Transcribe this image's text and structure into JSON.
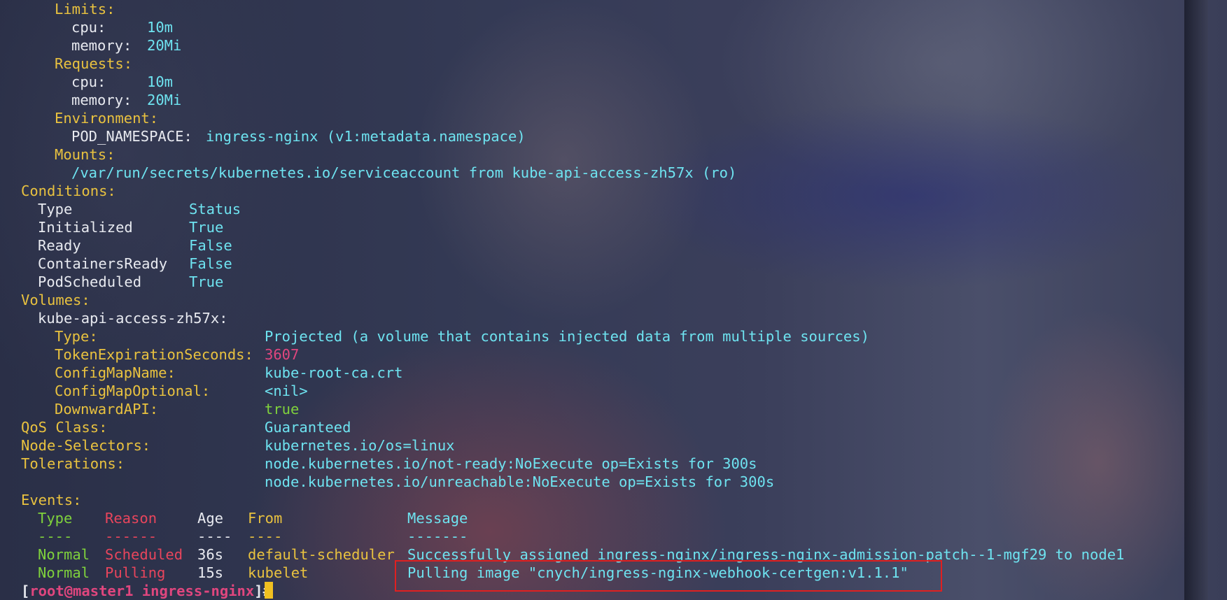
{
  "limits": {
    "heading": "Limits",
    "cpu_label": "cpu:",
    "cpu_value": "10m",
    "memory_label": "memory:",
    "memory_value": "20Mi"
  },
  "requests": {
    "heading": "Requests",
    "cpu_label": "cpu:",
    "cpu_value": "10m",
    "memory_label": "memory:",
    "memory_value": "20Mi"
  },
  "environment": {
    "heading": "Environment",
    "var_name": "POD_NAMESPACE:",
    "var_value": "ingress-nginx (v1:metadata.namespace)"
  },
  "mounts": {
    "heading": "Mounts",
    "value": "/var/run/secrets/kubernetes.io/serviceaccount from kube-api-access-zh57x (ro)"
  },
  "conditions": {
    "heading": "Conditions",
    "col_type": "Type",
    "col_status": "Status",
    "rows": [
      {
        "type": "Initialized",
        "status": "True"
      },
      {
        "type": "Ready",
        "status": "False"
      },
      {
        "type": "ContainersReady",
        "status": "False"
      },
      {
        "type": "PodScheduled",
        "status": "True"
      }
    ]
  },
  "volumes": {
    "heading": "Volumes",
    "name": "kube-api-access-zh57x:",
    "type_label": "Type:",
    "type_value": "Projected (a volume that contains injected data from multiple sources)",
    "token_label": "TokenExpirationSeconds:",
    "token_value": "3607",
    "cm_name_label": "ConfigMapName:",
    "cm_name_value": "kube-root-ca.crt",
    "cm_optional_label": "ConfigMapOptional:",
    "cm_optional_value": "<nil>",
    "downward_label": "DownwardAPI:",
    "downward_value": "true"
  },
  "qos": {
    "label": "QoS Class:",
    "value": "Guaranteed"
  },
  "node_selectors": {
    "label": "Node-Selectors:",
    "value": "kubernetes.io/os=linux"
  },
  "tolerations": {
    "label": "Tolerations:",
    "values": [
      "node.kubernetes.io/not-ready:NoExecute op=Exists for 300s",
      "node.kubernetes.io/unreachable:NoExecute op=Exists for 300s"
    ]
  },
  "events": {
    "heading": "Events",
    "headers": {
      "type": "Type",
      "reason": "Reason",
      "age": "Age",
      "from": "From",
      "message": "Message"
    },
    "separators": {
      "type": "----",
      "reason": "------",
      "age": "----",
      "from": "----",
      "message": "-------"
    },
    "rows": [
      {
        "type": "Normal",
        "reason": "Scheduled",
        "age": "36s",
        "from": "default-scheduler",
        "message": "Successfully assigned ingress-nginx/ingress-nginx-admission-patch--1-mgf29 to node1"
      },
      {
        "type": "Normal",
        "reason": "Pulling",
        "age": "15s",
        "from": "kubelet",
        "message": "Pulling image \"cnych/ingress-nginx-webhook-certgen:v1.1.1\""
      }
    ]
  },
  "prompt": {
    "open": "[",
    "user_host": "root@master1",
    "dir": "ingress-nginx",
    "close": "]#"
  },
  "colors": {
    "heading": "#e9c23f",
    "value": "#6ee3f0",
    "text": "#e8eaf0",
    "number": "#e0467e",
    "true": "#7fd23c",
    "prompt": "#e0467e",
    "highlight_box": "#e02020",
    "cursor": "#f0c020"
  }
}
